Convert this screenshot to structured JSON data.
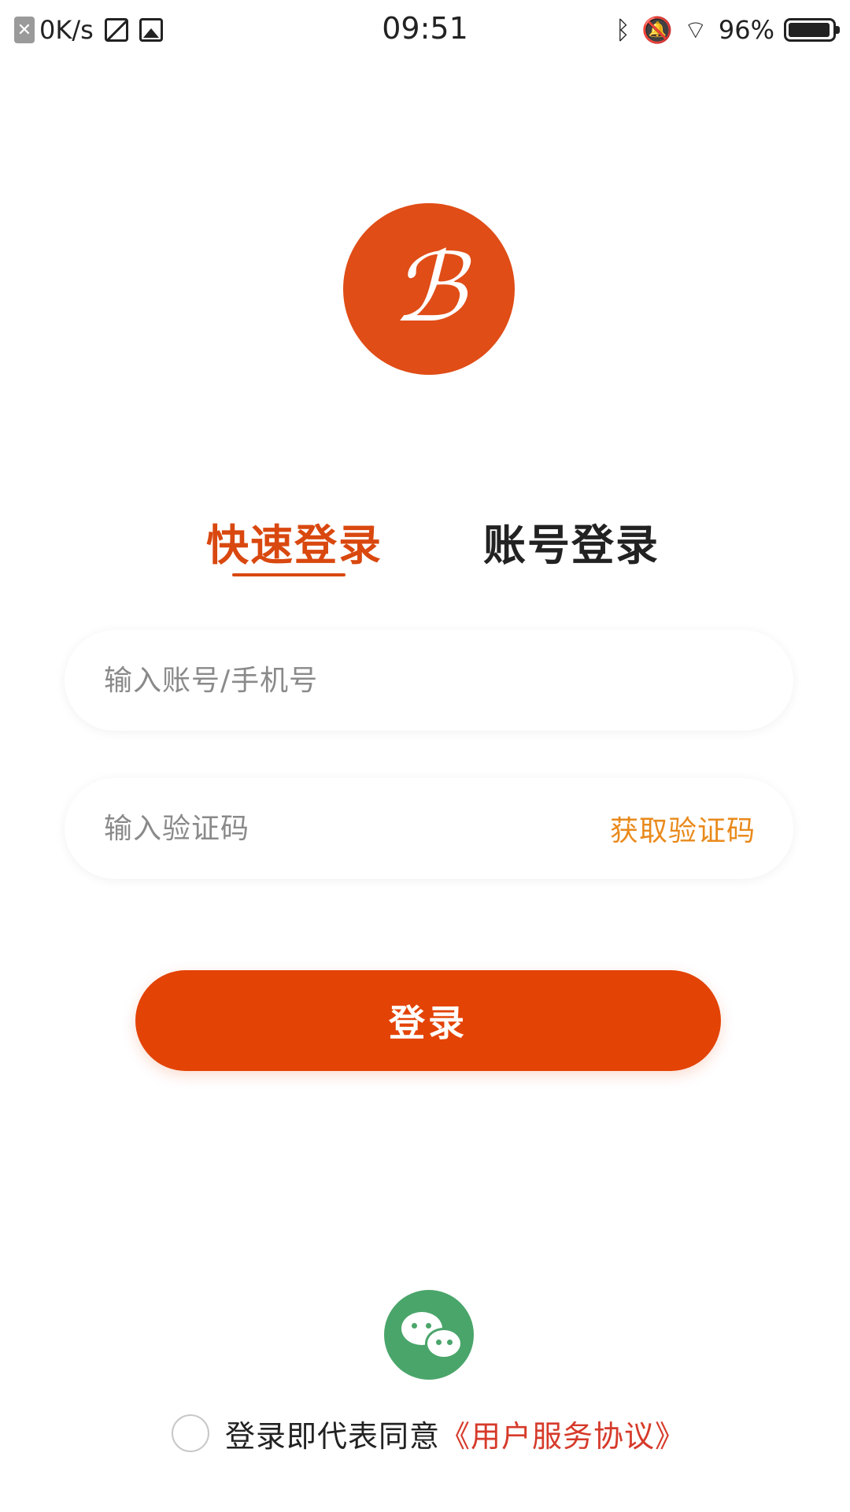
{
  "status_bar": {
    "net_speed": "0K/s",
    "time": "09:51",
    "battery_percent": "96%",
    "battery_level": 0.96,
    "icons": [
      "close-badge-icon",
      "screenshot-icon",
      "image-icon",
      "bluetooth-icon",
      "mute-bell-icon",
      "wifi-icon",
      "battery-icon"
    ]
  },
  "logo": {
    "icon": "app-logo"
  },
  "tabs": [
    {
      "label": "快速登录",
      "active": true
    },
    {
      "label": "账号登录",
      "active": false
    }
  ],
  "form": {
    "account_placeholder": "输入账号/手机号",
    "code_placeholder": "输入验证码",
    "get_code_label": "获取验证码",
    "login_label": "登录"
  },
  "wechat": {
    "icon": "wechat-icon"
  },
  "agreement": {
    "text": "登录即代表同意",
    "link": "《用户服务协议》"
  },
  "colors": {
    "accent": "#d9480f",
    "button": "#e34305",
    "get_code": "#e98a1c",
    "link": "#d63a2a",
    "wechat": "#4aa56a"
  }
}
